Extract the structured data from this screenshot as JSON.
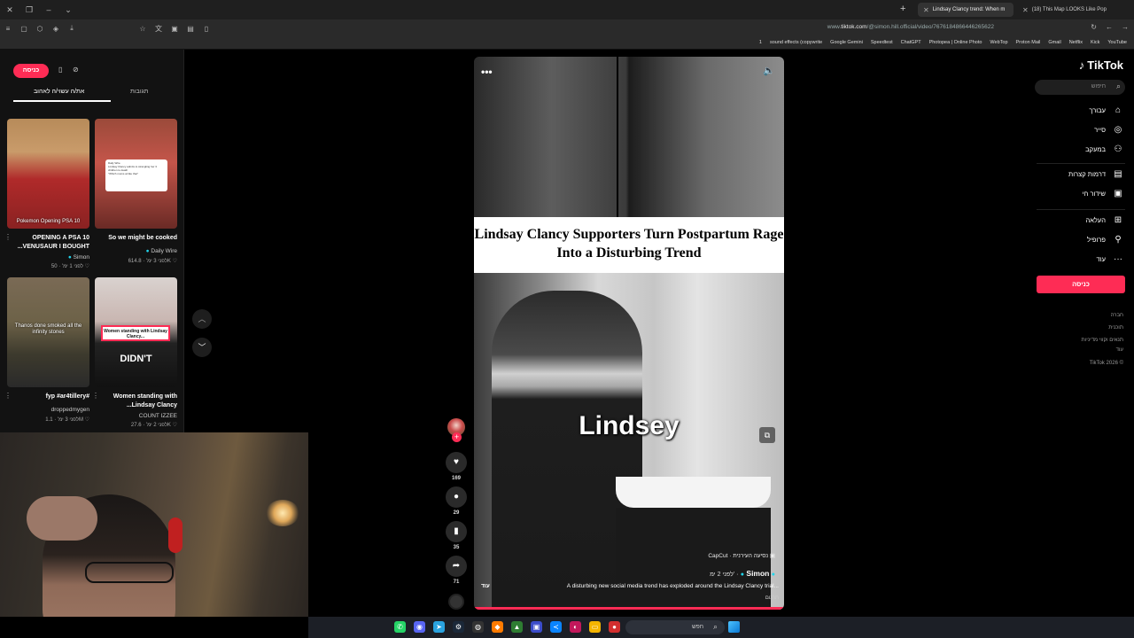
{
  "browser": {
    "tabs": [
      {
        "title": "Lindsay Clancy trend: When m"
      },
      {
        "title": "(18) This Map LOOKS Like Pop"
      }
    ],
    "url_prefix": "www.",
    "url_domain": "tiktok.com",
    "url_path": "/@simon.hill.official/video/7676184866446265622",
    "bookmarks": [
      "1",
      "sound effects (copywrite",
      "Google Gemini",
      "Speedtest",
      "ChatGPT",
      "Photopea | Online Photo",
      "WebTop",
      "Proton Mail",
      "Gmail",
      "Netflix",
      "Kick",
      "YouTube"
    ]
  },
  "left_panel": {
    "login_label": "כניסה",
    "tab_you_may_like": "את/ה עשוי/ה לאהוב",
    "tab_comments": "תגובות",
    "videos": [
      {
        "title": "OPENING A PSA 10 ...VENUSAUR I BOUGHT",
        "author": "Simon",
        "time": "לפני 1 ימ'",
        "likes": "50",
        "overlay": "Pokemon Opening PSA 10"
      },
      {
        "title": "So we might be cooked",
        "author": "Daily Wire",
        "time": "לפני 3 ימ'",
        "likes": "614.8K",
        "overlay": ""
      },
      {
        "title": "fyp #ar4tillery#",
        "author": "droppedmygen",
        "time": "לפני 3 ימ'",
        "likes": "1.1M",
        "overlay": "Thanos done smoked all the infinity stones"
      },
      {
        "title": "Women standing with ...Lindsay Clancy",
        "author": "COUNT IZZEE",
        "time": "לפני 2 ימ'",
        "likes": "27.6K",
        "overlay": "Women standing with Lindsay Clancy..."
      }
    ],
    "didnt_overlay": "DIDN'T"
  },
  "video": {
    "headline": "Lindsay Clancy Supporters Turn Postpartum Rage Into a Disturbing Trend",
    "caption": "Lindsey",
    "capcut": "CapCut · נסיעה העירנית",
    "author": "Simon",
    "time": "לפני 2 ימ' ·",
    "description": "A disturbing new social media trend has exploded around the Lindsay Clancy trial...",
    "more_link": "עוד",
    "translate": "תרגום",
    "likes": "169",
    "comments": "29",
    "saves": "35",
    "shares": "71"
  },
  "sidebar": {
    "brand": "TikTok",
    "search_placeholder": "חיפוש",
    "nav": [
      {
        "label": "עבורך",
        "icon": "home-icon"
      },
      {
        "label": "סייר",
        "icon": "compass-icon"
      },
      {
        "label": "במעקב",
        "icon": "user-plus-icon"
      },
      {
        "label": "דרמות קצרות",
        "icon": "film-icon"
      },
      {
        "label": "שידור חי",
        "icon": "live-icon"
      },
      {
        "label": "העלאה",
        "icon": "upload-icon"
      },
      {
        "label": "פרופיל",
        "icon": "profile-icon"
      },
      {
        "label": "עוד",
        "icon": "more-icon"
      }
    ],
    "login_label": "כניסה",
    "footer": [
      "חברה",
      "תוכנית",
      "תנאים וקווי מדיניות",
      "עוד",
      "TikTok 2026 ©"
    ]
  },
  "taskbar": {
    "search_placeholder": "חפש"
  },
  "colors": {
    "accent": "#fe2c55",
    "background": "#000000",
    "panel": "#121212"
  }
}
